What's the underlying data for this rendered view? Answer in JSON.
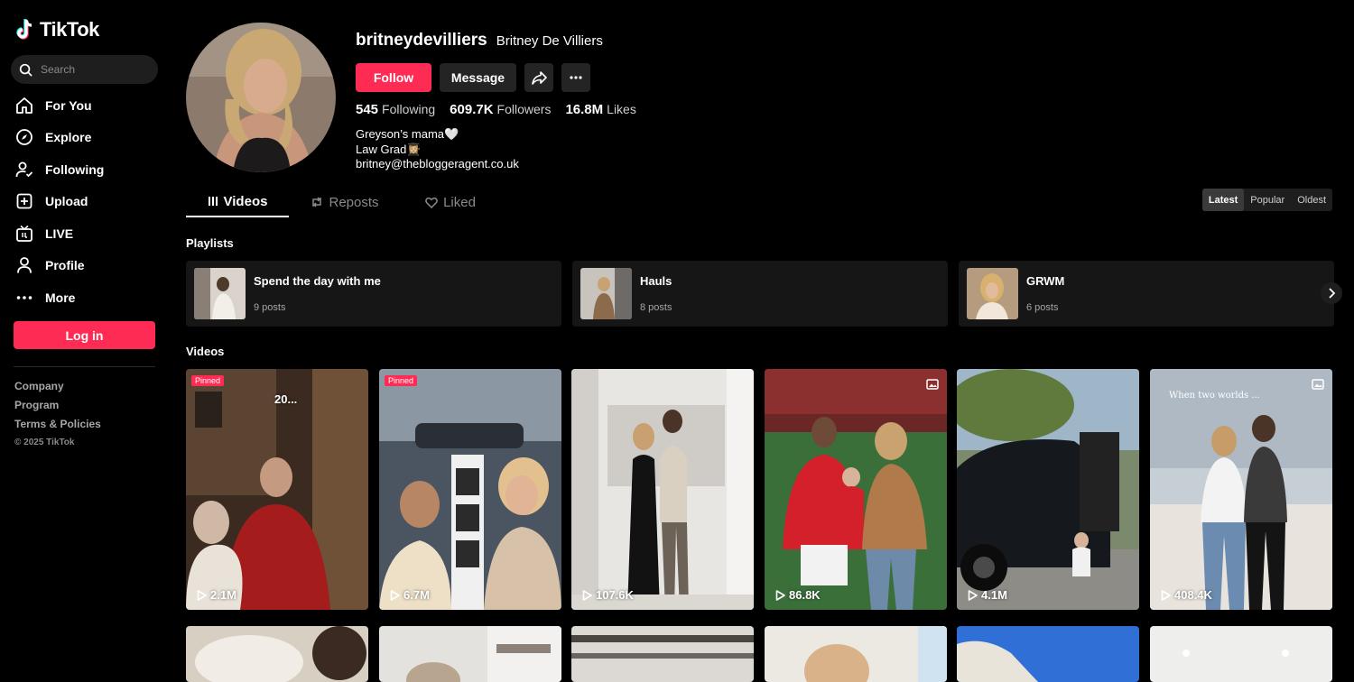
{
  "brand": {
    "name": "TikTok"
  },
  "search": {
    "placeholder": "Search"
  },
  "nav": [
    {
      "label": "For You",
      "icon": "home-icon"
    },
    {
      "label": "Explore",
      "icon": "compass-icon"
    },
    {
      "label": "Following",
      "icon": "following-icon"
    },
    {
      "label": "Upload",
      "icon": "upload-icon"
    },
    {
      "label": "LIVE",
      "icon": "live-icon"
    },
    {
      "label": "Profile",
      "icon": "profile-icon"
    },
    {
      "label": "More",
      "icon": "more-icon"
    }
  ],
  "login": {
    "label": "Log in"
  },
  "footer": {
    "links": [
      "Company",
      "Program",
      "Terms & Policies"
    ],
    "copyright": "© 2025 TikTok"
  },
  "profile": {
    "username": "britneydevilliers",
    "nickname": "Britney De Villiers",
    "follow_label": "Follow",
    "message_label": "Message",
    "stats": [
      {
        "value": "545",
        "label": "Following"
      },
      {
        "value": "609.7K",
        "label": "Followers"
      },
      {
        "value": "16.8M",
        "label": "Likes"
      }
    ],
    "bio": [
      "Greyson’s mama🤍",
      "Law Grad👩🏼‍🎓",
      "britney@thebloggeragent.co.uk"
    ]
  },
  "tabs": [
    {
      "label": "Videos",
      "icon": "grid-icon",
      "active": true
    },
    {
      "label": "Reposts",
      "icon": "repost-icon",
      "active": false
    },
    {
      "label": "Liked",
      "icon": "liked-icon",
      "active": false
    }
  ],
  "sort": {
    "options": [
      "Latest",
      "Popular",
      "Oldest"
    ],
    "selected": "Latest"
  },
  "playlists_title": "Playlists",
  "playlists": [
    {
      "name": "Spend the day with me",
      "count": "9 posts"
    },
    {
      "name": "Hauls",
      "count": "8 posts"
    },
    {
      "name": "GRWM",
      "count": "6 posts"
    }
  ],
  "videos_title": "Videos",
  "videos": [
    {
      "views": "2.1M",
      "badge": "Pinned",
      "overlay": "20..."
    },
    {
      "views": "6.7M",
      "badge": "Pinned",
      "overlay": ""
    },
    {
      "views": "107.6K",
      "badge": "",
      "overlay": ""
    },
    {
      "views": "86.8K",
      "badge": "",
      "overlay": ""
    },
    {
      "views": "4.1M",
      "badge": "",
      "overlay": ""
    },
    {
      "views": "408.4K",
      "badge": "",
      "overlay": "When two worlds ..."
    }
  ],
  "colors": {
    "accent": "#fe2c55",
    "background": "#000000",
    "surface": "#161616"
  }
}
